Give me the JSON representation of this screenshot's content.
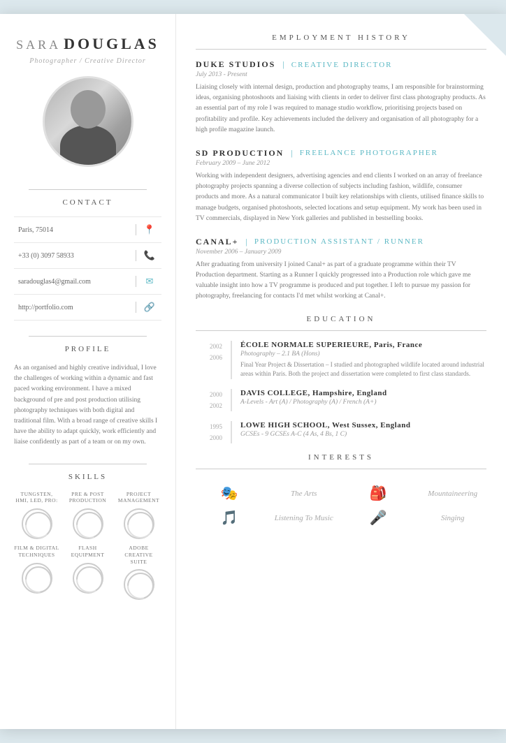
{
  "sidebar": {
    "name_first": "SARA",
    "name_last": "DOUGLAS",
    "subtitle": "Photographer / Creative Director",
    "contact_title": "CONTACT",
    "contact_items": [
      {
        "text": "Paris, 75014",
        "icon": "📍"
      },
      {
        "text": "+33 (0) 3097 58933",
        "icon": "📞"
      },
      {
        "text": "saradouglas4@gmail.com",
        "icon": "✉"
      },
      {
        "text": "http://portfolio.com",
        "icon": "🔗"
      }
    ],
    "profile_title": "PROFILE",
    "profile_text": "As an organised and highly creative individual, I love the challenges of working within a dynamic and fast paced working environment. I have a mixed background of pre and post production utilising photography techniques with both digital and traditional film. With a broad range of creative skills I have the ability to adapt quickly, work efficiently and liaise confidently as part of a team or on my own.",
    "skills_title": "SKILLS",
    "skills": [
      {
        "label": "TUNGSTEN, HMI, LED, PRO:",
        "level": 65
      },
      {
        "label": "PRE & POST PRODUCTION",
        "level": 70
      },
      {
        "label": "PROJECT MANAGEMENT",
        "level": 60
      },
      {
        "label": "FILM & DIGITAL TECHNIQUES",
        "level": 75
      },
      {
        "label": "FLASH EQUIPMENT",
        "level": 68
      },
      {
        "label": "ADOBE CREATIVE SUITE",
        "level": 72
      }
    ]
  },
  "main": {
    "employment_title": "EMPLOYMENT HISTORY",
    "jobs": [
      {
        "company": "DUKE STUDIOS",
        "title": "CREATIVE DIRECTOR",
        "dates": "July 2013 - Present",
        "desc": "Liaising closely with internal design, production and photography teams, I am responsible for brainstorming ideas, organising photoshoots and liaising with clients in order to deliver first class photography products.  As an essential part of my role I was required to manage studio workflow, prioritising projects based on profitability and profile.  Key achievements included the delivery and organisation of all photography for a high profile magazine launch."
      },
      {
        "company": "SD PRODUCTION",
        "title": "FREELANCE PHOTOGRAPHER",
        "dates": "February 2009 – June 2012",
        "desc": "Working with independent designers, advertising agencies and end clients I worked on an array of freelance photography projects spanning a diverse collection of subjects including fashion, wildlife, consumer products and more.  As a natural communicator I built key relationships with clients, utilised finance skills to manage budgets, organised photoshoots, selected locations and setup equipment.  My work has been used in TV commercials, displayed in New York galleries and published in bestselling books."
      },
      {
        "company": "CANAL+",
        "title": "PRODUCTION ASSISTANT / RUNNER",
        "dates": "November 2006 – January 2009",
        "desc": "After graduating from university I joined Canal+ as part of a graduate programme within their TV Production department.  Starting as a Runner I quickly progressed into a Production role which gave me valuable insight into how a TV programme is produced and put together. I left to pursue my passion for photography, freelancing for contacts I'd met whilst working at Canal+."
      }
    ],
    "education_title": "EDUCATION",
    "education": [
      {
        "year_start": "2002",
        "year_end": "2006",
        "school": "ÉCOLE NORMALE SUPERIEURE, Paris, France",
        "degree": "Photography – 2.1 BA (Hons)",
        "desc": "Final Year Project & Dissertation – I studied and photographed wildlife located around industrial areas within Paris. Both the project and dissertation were completed to first class standards."
      },
      {
        "year_start": "2000",
        "year_end": "2002",
        "school": "DAVIS COLLEGE, Hampshire, England",
        "degree": "A-Levels - Art (A) / Photography (A) / French (A+)",
        "desc": ""
      },
      {
        "year_start": "1995",
        "year_end": "2000",
        "school": "LOWE HIGH SCHOOL, West Sussex, England",
        "degree": "GCSEs - 9 GCSEs A-C (4 As, 4 Bs, 1 C)",
        "desc": ""
      }
    ],
    "interests_title": "INTERESTS",
    "interests": [
      {
        "icon": "🎭",
        "label": "The Arts"
      },
      {
        "icon": "🎒",
        "label": "Mountaineering"
      },
      {
        "icon": "🎵",
        "label": "Listening To Music"
      },
      {
        "icon": "🎤",
        "label": "Singing"
      }
    ]
  }
}
